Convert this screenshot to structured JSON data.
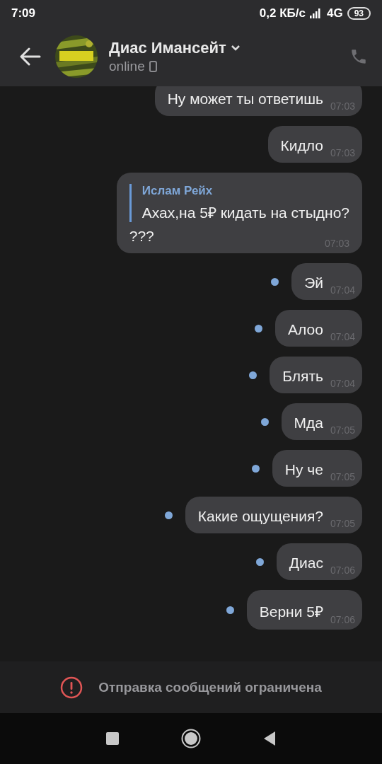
{
  "status_bar": {
    "time": "7:09",
    "network_speed": "0,2 КБ/с",
    "network_type": "4G",
    "battery": "93"
  },
  "header": {
    "name": "Диас Имансейт",
    "status": "online"
  },
  "messages": [
    {
      "text": "Ну может ты ответишь",
      "time": "07:03",
      "unread": false
    },
    {
      "text": "Кидло",
      "time": "07:03",
      "unread": false
    },
    {
      "reply": {
        "author": "Ислам Рейх",
        "text": "Ахах,на 5₽ кидать на стыдно?"
      },
      "text": "???",
      "time": "07:03",
      "unread": false
    },
    {
      "text": "Эй",
      "time": "07:04",
      "unread": true
    },
    {
      "text": "Алоо",
      "time": "07:04",
      "unread": true
    },
    {
      "text": "Блять",
      "time": "07:04",
      "unread": true
    },
    {
      "text": "Мда",
      "time": "07:05",
      "unread": true
    },
    {
      "text": "Ну че",
      "time": "07:05",
      "unread": true
    },
    {
      "text": "Какие ощущения?",
      "time": "07:05",
      "unread": true
    },
    {
      "text": "Диас",
      "time": "07:06",
      "unread": true
    },
    {
      "text": "Верни 5₽",
      "time": "07:06",
      "unread": true
    }
  ],
  "notice": {
    "text": "Отправка сообщений ограничена"
  }
}
